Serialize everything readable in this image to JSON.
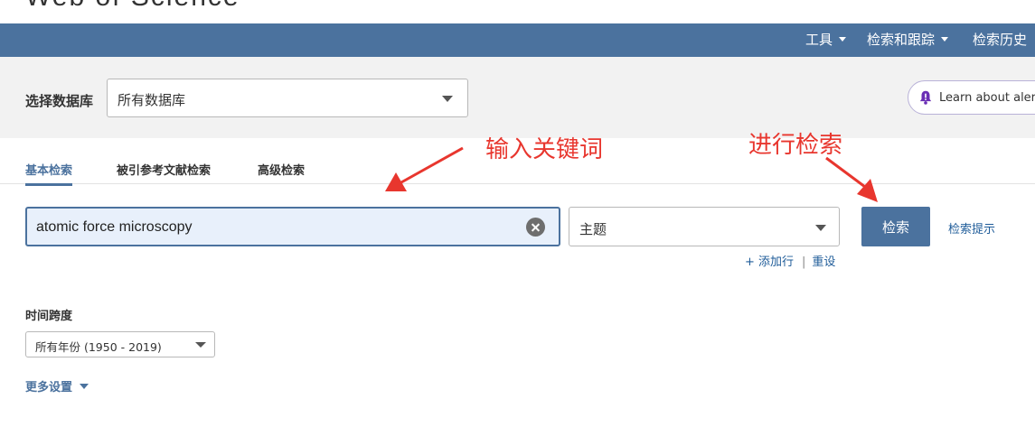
{
  "app": {
    "title": "Web of Science"
  },
  "topnav": {
    "items": [
      {
        "label": "工具",
        "has_dropdown": true
      },
      {
        "label": "检索和跟踪",
        "has_dropdown": true
      },
      {
        "label": "检索历史",
        "has_dropdown": false
      }
    ]
  },
  "database": {
    "label": "选择数据库",
    "selected": "所有数据库"
  },
  "alert_banner": {
    "text": "Learn about alerting",
    "icon": "bell-icon"
  },
  "tabs": [
    {
      "label": "基本检索",
      "active": true
    },
    {
      "label": "被引参考文献检索",
      "active": false
    },
    {
      "label": "高级检索",
      "active": false
    }
  ],
  "search": {
    "query": "atomic force microscopy",
    "field": "主题",
    "submit_label": "检索",
    "tips_label": "检索提示",
    "add_row_label": "+ 添加行",
    "separator": "|",
    "reset_label": "重设"
  },
  "timespan": {
    "label": "时间跨度",
    "selected": "所有年份 (1950 - 2019)"
  },
  "more_settings": {
    "label": "更多设置"
  },
  "annotations": {
    "keyword_hint": "输入关键词",
    "search_hint": "进行检索"
  },
  "colors": {
    "nav_bar": "#4b729e",
    "accent": "#4b729e",
    "link": "#1f5c99",
    "annotation": "#e8362e",
    "band_bg": "#f2f2f2",
    "input_bg": "#e8f0fb",
    "alert_icon": "#6a2fb5"
  }
}
